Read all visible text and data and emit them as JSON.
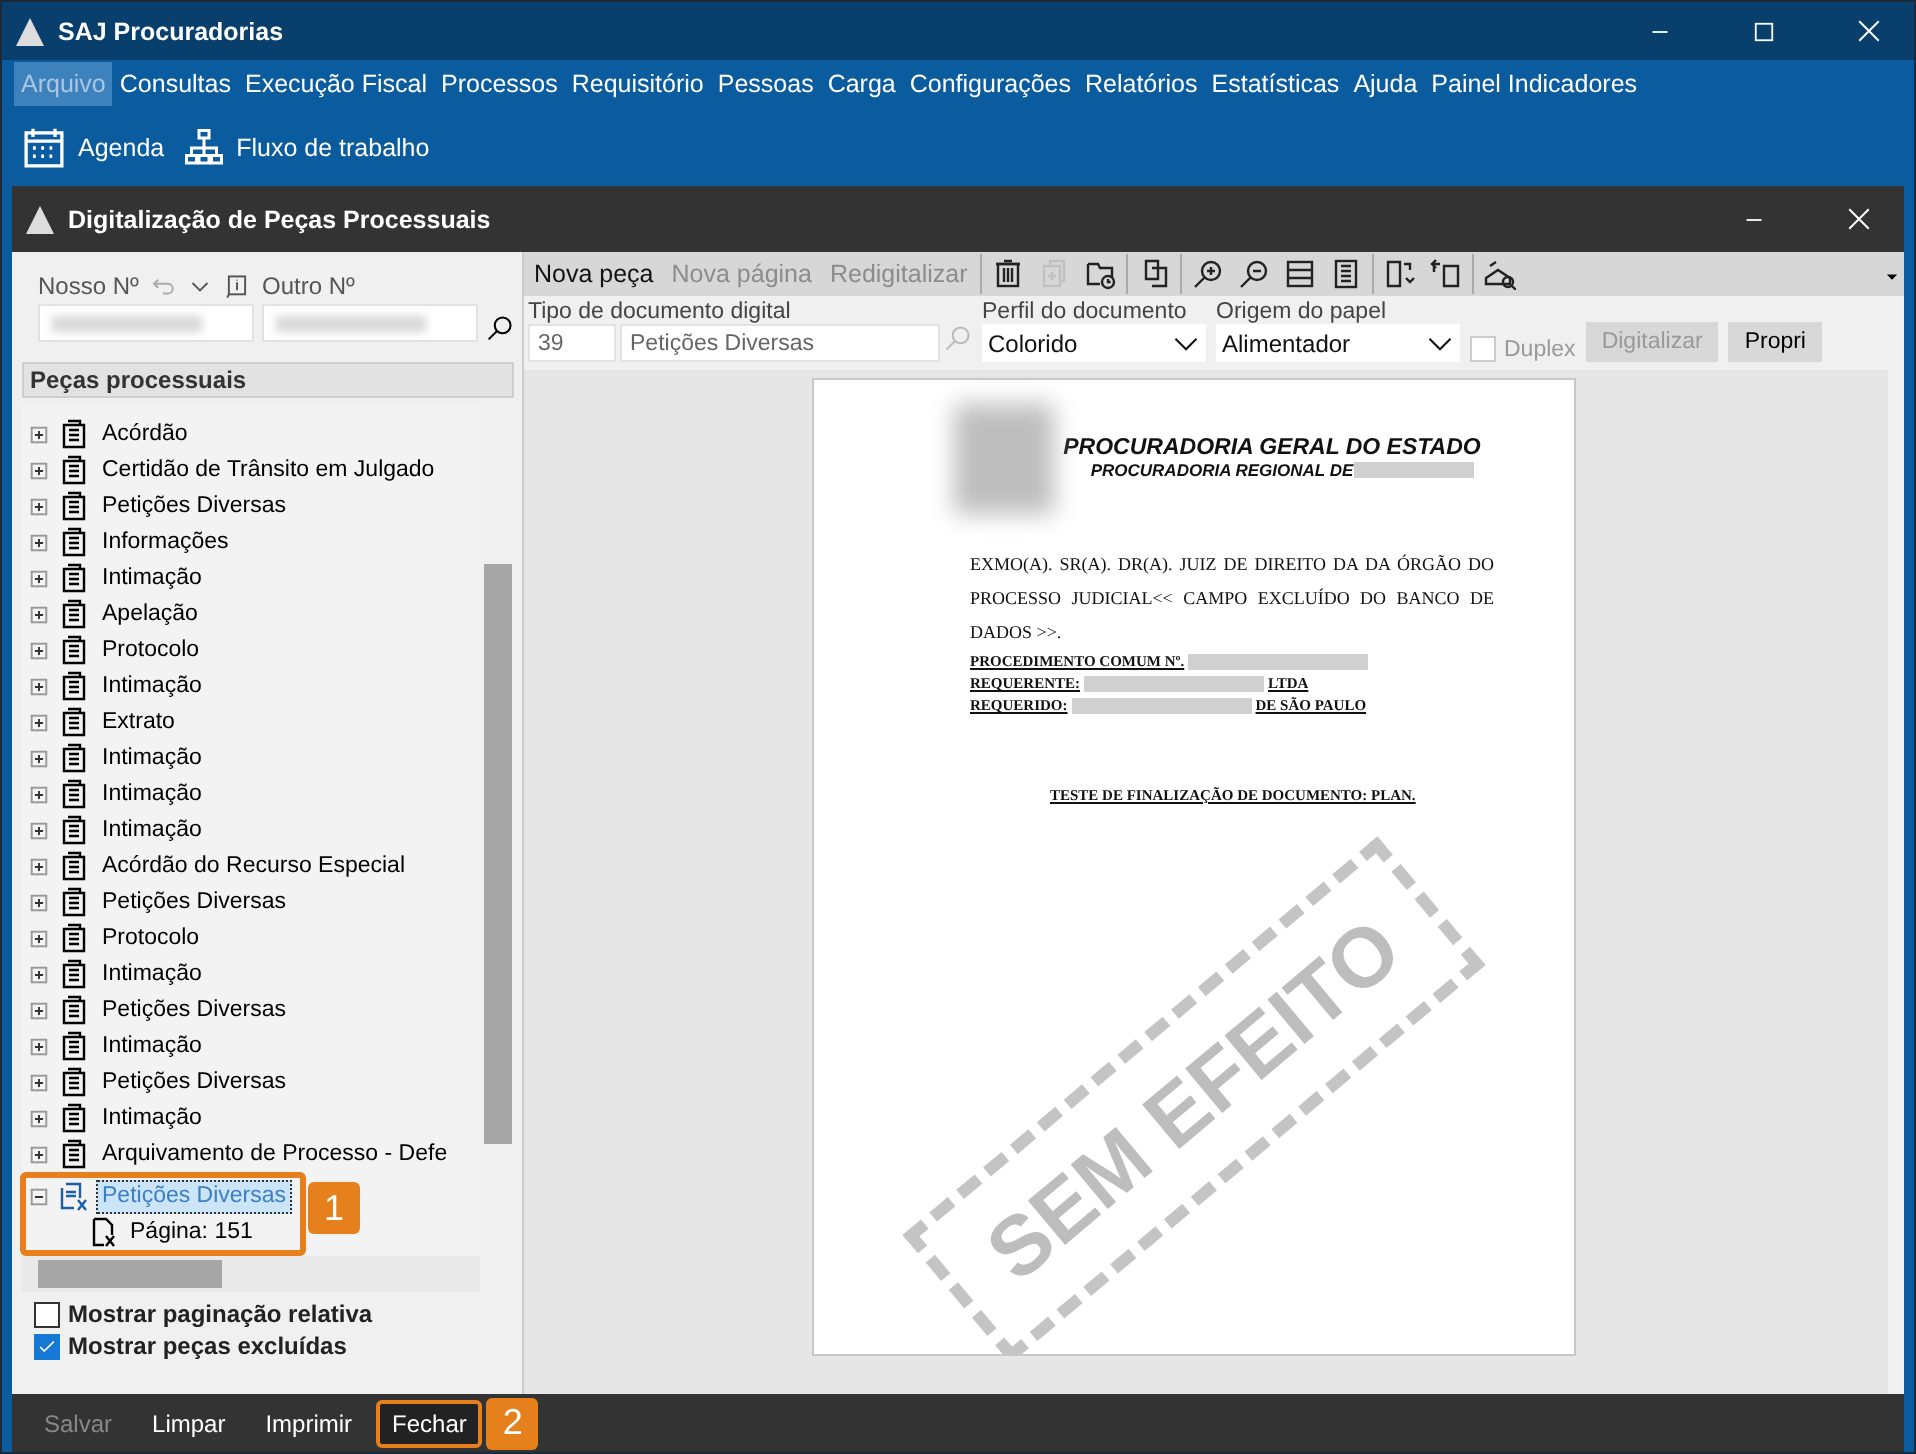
{
  "window": {
    "title": "SAJ Procuradorias"
  },
  "menu": [
    {
      "label": "Arquivo",
      "selected": true
    },
    {
      "label": "Consultas",
      "selected": false
    },
    {
      "label": "Execução Fiscal",
      "selected": false
    },
    {
      "label": "Processos",
      "selected": false
    },
    {
      "label": "Requisitório",
      "selected": false
    },
    {
      "label": "Pessoas",
      "selected": false
    },
    {
      "label": "Carga",
      "selected": false
    },
    {
      "label": "Configurações",
      "selected": false
    },
    {
      "label": "Relatórios",
      "selected": false
    },
    {
      "label": "Estatísticas",
      "selected": false
    },
    {
      "label": "Ajuda",
      "selected": false
    },
    {
      "label": "Painel Indicadores",
      "selected": false
    }
  ],
  "toolbar": [
    {
      "kind": "calendar",
      "label": "Agenda"
    },
    {
      "kind": "workflow",
      "label": "Fluxo de trabalho"
    }
  ],
  "dialog": {
    "title": "Digitalização de Peças Processuais",
    "search": {
      "nosso_label": "Nosso Nº",
      "outro_label": "Outro Nº"
    },
    "tree_header": "Peças processuais",
    "tree": [
      {
        "label": "Acórdão",
        "expanded": false,
        "selected": false,
        "excluded": false
      },
      {
        "label": "Certidão de Trânsito em Julgado",
        "expanded": false,
        "selected": false,
        "excluded": false
      },
      {
        "label": "Petições Diversas",
        "expanded": false,
        "selected": false,
        "excluded": false
      },
      {
        "label": "Informações",
        "expanded": false,
        "selected": false,
        "excluded": false
      },
      {
        "label": "Intimação",
        "expanded": false,
        "selected": false,
        "excluded": false
      },
      {
        "label": "Apelação",
        "expanded": false,
        "selected": false,
        "excluded": false
      },
      {
        "label": "Protocolo",
        "expanded": false,
        "selected": false,
        "excluded": false
      },
      {
        "label": "Intimação",
        "expanded": false,
        "selected": false,
        "excluded": false
      },
      {
        "label": "Extrato",
        "expanded": false,
        "selected": false,
        "excluded": false
      },
      {
        "label": "Intimação",
        "expanded": false,
        "selected": false,
        "excluded": false
      },
      {
        "label": "Intimação",
        "expanded": false,
        "selected": false,
        "excluded": false
      },
      {
        "label": "Intimação",
        "expanded": false,
        "selected": false,
        "excluded": false
      },
      {
        "label": "Acórdão do Recurso Especial",
        "expanded": false,
        "selected": false,
        "excluded": false
      },
      {
        "label": "Petições Diversas",
        "expanded": false,
        "selected": false,
        "excluded": false
      },
      {
        "label": "Protocolo",
        "expanded": false,
        "selected": false,
        "excluded": false
      },
      {
        "label": "Intimação",
        "expanded": false,
        "selected": false,
        "excluded": false
      },
      {
        "label": "Petições Diversas",
        "expanded": false,
        "selected": false,
        "excluded": false
      },
      {
        "label": "Intimação",
        "expanded": false,
        "selected": false,
        "excluded": false
      },
      {
        "label": "Petições Diversas",
        "expanded": false,
        "selected": false,
        "excluded": false
      },
      {
        "label": "Intimação",
        "expanded": false,
        "selected": false,
        "excluded": false
      },
      {
        "label": "Arquivamento de Processo - Defe",
        "expanded": false,
        "selected": false,
        "excluded": false
      },
      {
        "label": "Petições Diversas",
        "expanded": true,
        "selected": true,
        "excluded": true,
        "callout": "1",
        "children": [
          {
            "label": "Página: 151",
            "selected": false,
            "excluded": true
          }
        ]
      }
    ],
    "options": [
      {
        "label": "Mostrar paginação relativa",
        "checked": false
      },
      {
        "label": "Mostrar peças excluídas",
        "checked": true
      }
    ],
    "actions": [
      {
        "label": "Nova peça",
        "disabled": false
      },
      {
        "label": "Nova página",
        "disabled": true
      },
      {
        "label": "Redigitalizar",
        "disabled": true
      }
    ],
    "tools": [
      {
        "kind": "trash",
        "disabled": false
      },
      {
        "kind": "copy",
        "disabled": true
      },
      {
        "kind": "history",
        "disabled": false
      },
      {
        "kind": "separator"
      },
      {
        "kind": "pages",
        "disabled": false
      },
      {
        "kind": "separator"
      },
      {
        "kind": "zoom-in",
        "disabled": false
      },
      {
        "kind": "zoom-out",
        "disabled": false
      },
      {
        "kind": "fit-width",
        "disabled": false
      },
      {
        "kind": "fit-page",
        "disabled": false
      },
      {
        "kind": "separator"
      },
      {
        "kind": "rotate-right",
        "disabled": false
      },
      {
        "kind": "rotate-left",
        "disabled": false
      },
      {
        "kind": "separator"
      },
      {
        "kind": "scanner",
        "disabled": false
      }
    ],
    "doc_type": {
      "label": "Tipo de documento digital",
      "code": "39",
      "name": "Petições Diversas"
    },
    "profile": {
      "label": "Perfil do documento",
      "value": "Colorido"
    },
    "source": {
      "label": "Origem do papel",
      "value": "Alimentador"
    },
    "duplex": {
      "label": "Duplex",
      "checked": false,
      "disabled": true
    },
    "scan_buttons": [
      {
        "label": "Digitalizar",
        "disabled": true
      },
      {
        "label": "Propri",
        "disabled": false
      }
    ],
    "document": {
      "heading": "PROCURADORIA GERAL DO ESTADO",
      "subheading": "PROCURADORIA REGIONAL DE",
      "paragraph": "EXMO(A). SR(A). DR(A). JUIZ DE DIREITO DA  DA ÓRGÃO DO PROCESSO JUDICIAL<< CAMPO EXCLUÍDO DO BANCO DE DADOS >>.",
      "fields": [
        {
          "label": "PROCEDIMENTO COMUM Nº."
        },
        {
          "label": "REQUERENTE:",
          "tail": "LTDA"
        },
        {
          "label": "REQUERIDO:",
          "tail": "DE SÃO PAULO"
        }
      ],
      "closing": "TESTE DE FINALIZAÇÃO DE DOCUMENTO: PLAN.",
      "stamp": "SEM EFEITO"
    },
    "footer": [
      {
        "label": "Salvar",
        "disabled": true
      },
      {
        "label": "Limpar",
        "disabled": false
      },
      {
        "label": "Imprimir",
        "disabled": false
      },
      {
        "label": "Fechar",
        "disabled": false,
        "callout": "2"
      }
    ]
  }
}
